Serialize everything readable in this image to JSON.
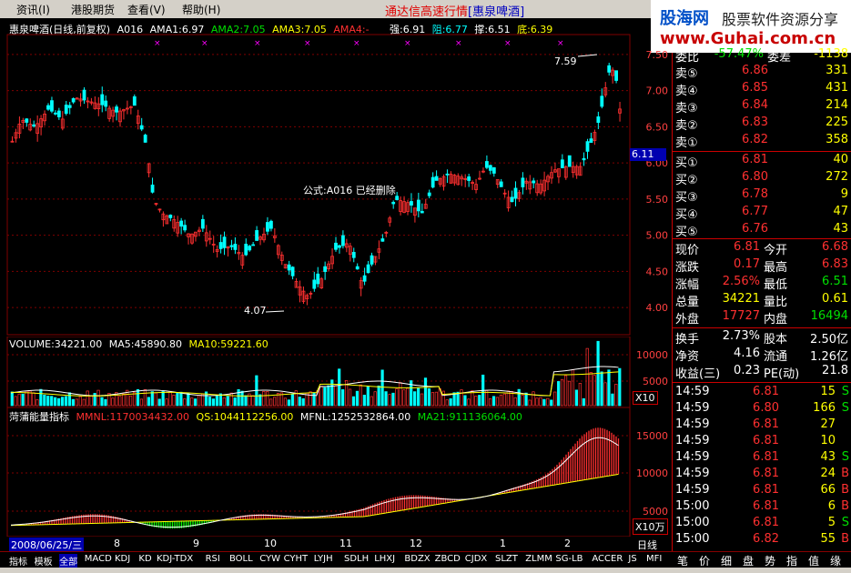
{
  "menu": {
    "items": [
      "资讯(I)",
      "港股期货",
      "查看(V)",
      "帮助(H)"
    ]
  },
  "banner": {
    "text": "通达信高速行情",
    "stock": "[惠泉啤酒]"
  },
  "logo": {
    "cn": "股海网",
    "slogan": "股票软件资源分享",
    "url": "www.Guhai.com.cn"
  },
  "kline": {
    "title": "惠泉啤酒(日线,前复权)",
    "formula": "A016",
    "ama1": "AMA1:6.97",
    "ama2": "AMA2:7.05",
    "ama3": "AMA3:7.05",
    "ama4": "AMA4:-",
    "strong": "强:6.91",
    "resist": "阻:6.77",
    "support": "撑:6.51",
    "bottom": "底:6.39",
    "notice": "公式:A016 已经删除",
    "high_label": "7.59",
    "low_label": "4.07",
    "price_tag": "6.11",
    "yticks": [
      "7.50",
      "7.00",
      "6.50",
      "6.00",
      "5.50",
      "5.00",
      "4.50",
      "4.00"
    ]
  },
  "volume": {
    "label": "VOLUME:34221.00",
    "ma5": "MA5:45890.80",
    "ma10": "MA10:59221.60",
    "yticks": [
      "10000",
      "5000"
    ],
    "unit": "X10"
  },
  "pupu": {
    "name": "菏蒲能量指标",
    "mmnl": "MMNL:1170034432.00",
    "qs": "QS:1044112256.00",
    "mfnl": "MFNL:1252532864.00",
    "ma21": "MA21:911136064.00",
    "yticks": [
      "15000",
      "10000",
      "5000"
    ],
    "unit": "X10万"
  },
  "dates": {
    "current": "2008/06/25/三",
    "months": [
      "8",
      "9",
      "10",
      "11",
      "12",
      "1",
      "2"
    ],
    "period": "日线"
  },
  "quote": {
    "top": {
      "label1": "委比",
      "val1": "-57.47%",
      "label2": "委差",
      "val2": "-1138"
    },
    "sells": [
      {
        "label": "卖⑤",
        "price": "6.86",
        "vol": "331"
      },
      {
        "label": "卖④",
        "price": "6.85",
        "vol": "431"
      },
      {
        "label": "卖③",
        "price": "6.84",
        "vol": "214"
      },
      {
        "label": "卖②",
        "price": "6.83",
        "vol": "225"
      },
      {
        "label": "卖①",
        "price": "6.82",
        "vol": "358"
      }
    ],
    "buys": [
      {
        "label": "买①",
        "price": "6.81",
        "vol": "40"
      },
      {
        "label": "买②",
        "price": "6.80",
        "vol": "272"
      },
      {
        "label": "买③",
        "price": "6.78",
        "vol": "9"
      },
      {
        "label": "买④",
        "price": "6.77",
        "vol": "47"
      },
      {
        "label": "买⑤",
        "price": "6.76",
        "vol": "43"
      }
    ],
    "stats": [
      {
        "l1": "现价",
        "v1": "6.81",
        "l2": "今开",
        "v2": "6.68"
      },
      {
        "l1": "涨跌",
        "v1": "0.17",
        "l2": "最高",
        "v2": "6.83"
      },
      {
        "l1": "涨幅",
        "v1": "2.56%",
        "l2": "最低",
        "v2": "6.51"
      },
      {
        "l1": "总量",
        "v1": "34221",
        "l2": "量比",
        "v2": "0.61"
      },
      {
        "l1": "外盘",
        "v1": "17727",
        "l2": "内盘",
        "v2": "16494"
      }
    ],
    "finance": [
      {
        "l1": "换手",
        "v1": "2.73%",
        "l2": "股本",
        "v2": "2.50亿"
      },
      {
        "l1": "净资",
        "v1": "4.16",
        "l2": "流通",
        "v2": "1.26亿"
      },
      {
        "l1": "收益(三)",
        "v1": "0.23",
        "l2": "PE(动)",
        "v2": "21.8"
      }
    ],
    "ticks": [
      {
        "time": "14:59",
        "price": "6.81",
        "vol": "15",
        "side": "S"
      },
      {
        "time": "14:59",
        "price": "6.80",
        "vol": "166",
        "side": "S"
      },
      {
        "time": "14:59",
        "price": "6.81",
        "vol": "27",
        "side": ""
      },
      {
        "time": "14:59",
        "price": "6.81",
        "vol": "10",
        "side": ""
      },
      {
        "time": "14:59",
        "price": "6.81",
        "vol": "43",
        "side": "S"
      },
      {
        "time": "14:59",
        "price": "6.81",
        "vol": "24",
        "side": "B"
      },
      {
        "time": "14:59",
        "price": "6.81",
        "vol": "66",
        "side": "B"
      },
      {
        "time": "15:00",
        "price": "6.81",
        "vol": "6",
        "side": "B"
      },
      {
        "time": "15:00",
        "price": "6.81",
        "vol": "5",
        "side": "S"
      },
      {
        "time": "15:00",
        "price": "6.82",
        "vol": "55",
        "side": "B"
      }
    ]
  },
  "tabs": [
    "指标",
    "模板",
    "全部",
    "MACD",
    "KDJ",
    "KD",
    "KDJ-TDX",
    "RSI",
    "BOLL",
    "CYW",
    "CYHT",
    "LYJH",
    "SDLH",
    "LHXJ",
    "BDZX",
    "ZBCD",
    "CJDX",
    "SLZT",
    "ZLMM",
    "SG-LB",
    "ACCER",
    "JS",
    "MFI"
  ],
  "rtabs": [
    "笔",
    "价",
    "细",
    "盘",
    "势",
    "指",
    "值",
    "缘"
  ],
  "colors": {
    "up": "#ff3030",
    "down": "#00ffff",
    "grid": "#800000"
  }
}
